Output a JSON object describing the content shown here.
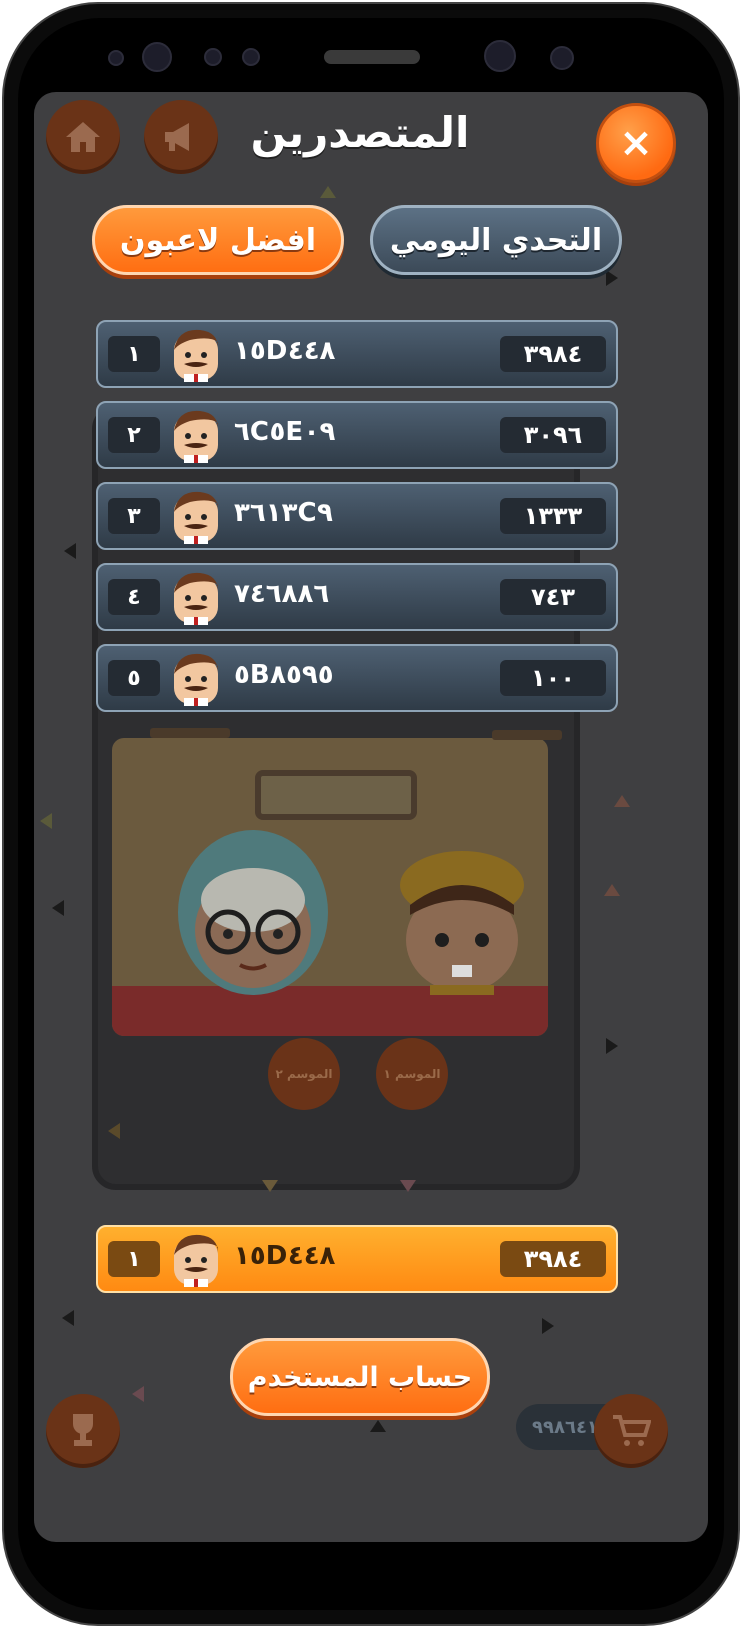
{
  "header": {
    "title": "المتصدرين",
    "close_icon": "close-icon",
    "home_icon": "home-icon",
    "sound_icon": "megaphone-icon"
  },
  "tabs": [
    {
      "label": "افضل لاعبون",
      "active": true
    },
    {
      "label": "التحدي اليومي",
      "active": false
    }
  ],
  "leaderboard": [
    {
      "rank": "١",
      "name": "١٥D٤٤٨",
      "score": "٣٩٨٤"
    },
    {
      "rank": "٢",
      "name": "٦C٥E٠٩",
      "score": "٣٠٩٦"
    },
    {
      "rank": "٣",
      "name": "٣٦١٣C٩",
      "score": "١٣٣٣"
    },
    {
      "rank": "٤",
      "name": "٧٤٦٨٨٦",
      "score": "٧٤٣"
    },
    {
      "rank": "٥",
      "name": "٥B٨٥٩٥",
      "score": "١٠٠"
    }
  ],
  "current_player": {
    "rank": "١",
    "name": "١٥D٤٤٨",
    "score": "٣٩٨٤"
  },
  "account_button": "حساب المستخدم",
  "background": {
    "season_1": "الموسم ١",
    "season_2": "الموسم ٢",
    "coins": "٩٩٨٦٤١",
    "trophy_icon": "trophy-icon",
    "cart_icon": "cart-icon"
  },
  "colors": {
    "accent_orange": "#ff7a1a",
    "row_blue": "#3f4f5f",
    "highlight_row": "#ff9a1e"
  }
}
